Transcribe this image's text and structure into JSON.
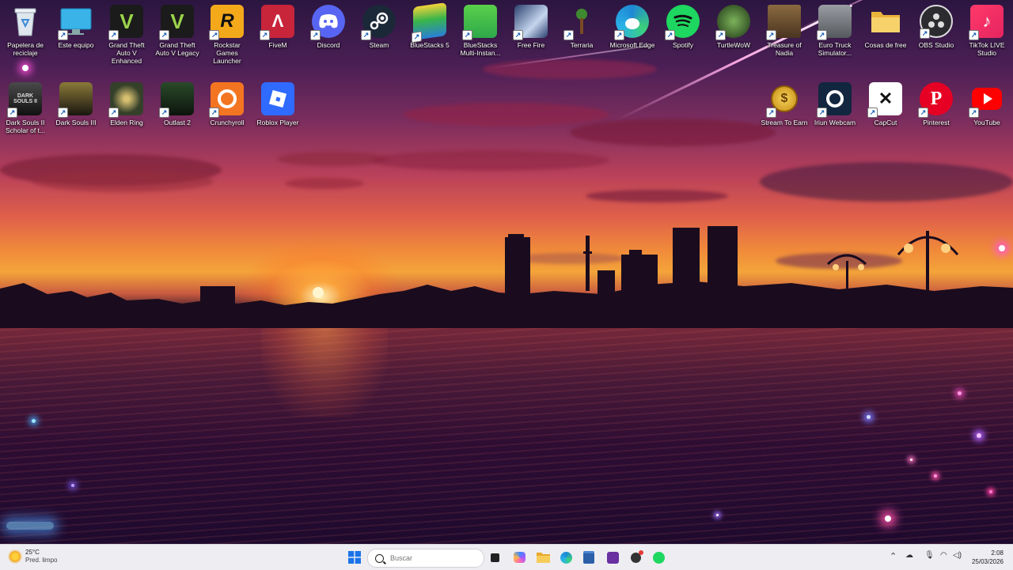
{
  "desktop": {
    "icons": [
      {
        "id": "papelera",
        "label": "Papelera de reciclaje",
        "icon": "recycle-bin-icon",
        "color": "#cfd6df"
      },
      {
        "id": "este-equipo",
        "label": "Este equipo",
        "icon": "computer-icon",
        "color": "#39b3e8"
      },
      {
        "id": "gta5-enhanced",
        "label": "Grand Theft Auto V Enhanced",
        "icon": "gta-v-icon",
        "color": "#1b1b1b"
      },
      {
        "id": "gta5-legacy",
        "label": "Grand Theft Auto V Legacy",
        "icon": "gta-v-icon",
        "color": "#1b1b1b"
      },
      {
        "id": "rockstar",
        "label": "Rockstar Games Launcher",
        "icon": "rockstar-icon",
        "color": "#f4a91b"
      },
      {
        "id": "fivem",
        "label": "FiveM",
        "icon": "fivem-icon",
        "color": "#c8243a"
      },
      {
        "id": "discord",
        "label": "Discord",
        "icon": "discord-icon",
        "color": "#5865f2"
      },
      {
        "id": "steam",
        "label": "Steam",
        "icon": "steam-icon",
        "color": "#1b2838"
      },
      {
        "id": "bluestacks5",
        "label": "BlueStacks 5",
        "icon": "bluestacks-icon",
        "color": "#2ea84a"
      },
      {
        "id": "bluestacks-multi",
        "label": "BlueStacks Multi-Instan...",
        "icon": "bluestacks-multi-icon",
        "color": "#3cc43a"
      },
      {
        "id": "freefire",
        "label": "Free Fire",
        "icon": "free-fire-icon",
        "color": "#2a3f6e"
      },
      {
        "id": "terraria",
        "label": "Terraria",
        "icon": "terraria-icon",
        "color": "#2f5e2a"
      },
      {
        "id": "edge",
        "label": "Microsoft Edge",
        "icon": "edge-icon",
        "color": "#1e88d4"
      },
      {
        "id": "spotify",
        "label": "Spotify",
        "icon": "spotify-icon",
        "color": "#1ed760"
      },
      {
        "id": "turtlewow",
        "label": "TurtleWoW",
        "icon": "turtlewow-icon",
        "color": "#4b6a3a"
      },
      {
        "id": "nadia",
        "label": "Treasure of Nadia",
        "icon": "nadia-icon",
        "color": "#6a5030"
      },
      {
        "id": "eurotruck",
        "label": "Euro Truck Simulator...",
        "icon": "euro-truck-icon",
        "color": "#6e6e70"
      },
      {
        "id": "cosas",
        "label": "Cosas de free",
        "icon": "folder-icon",
        "color": "#f2c94c"
      },
      {
        "id": "obs",
        "label": "OBS Studio",
        "icon": "obs-icon",
        "color": "#2c2c30"
      },
      {
        "id": "tiktok",
        "label": "TikTok LIVE Studio",
        "icon": "tiktok-icon",
        "color": "#e5245f"
      },
      {
        "id": "darksouls2",
        "label": "Dark Souls II Scholar of t...",
        "icon": "dark-souls-2-icon",
        "color": "#2a2a2a"
      },
      {
        "id": "darksouls3",
        "label": "Dark Souls III",
        "icon": "dark-souls-3-icon",
        "color": "#3a3320"
      },
      {
        "id": "eldenring",
        "label": "Elden Ring",
        "icon": "elden-ring-icon",
        "color": "#35402a"
      },
      {
        "id": "outlast2",
        "label": "Outlast 2",
        "icon": "outlast-icon",
        "color": "#1c2a1c"
      },
      {
        "id": "crunchyroll",
        "label": "Crunchyroll",
        "icon": "crunchyroll-icon",
        "color": "#f47521"
      },
      {
        "id": "roblox",
        "label": "Roblox Player",
        "icon": "roblox-icon",
        "color": "#2f6bff"
      },
      {
        "id": "streamtoearn",
        "label": "Stream To Earn",
        "icon": "coin-icon",
        "color": "#d9a521"
      },
      {
        "id": "iriun",
        "label": "Iriun Webcam",
        "icon": "webcam-icon",
        "color": "#12263f"
      },
      {
        "id": "capcut",
        "label": "CapCut",
        "icon": "capcut-icon",
        "color": "#ffffff"
      },
      {
        "id": "pinterest",
        "label": "Pinterest",
        "icon": "pinterest-icon",
        "color": "#e60023"
      },
      {
        "id": "youtube",
        "label": "YouTube",
        "icon": "youtube-icon",
        "color": "#ff0000"
      }
    ]
  },
  "taskbar": {
    "weather": {
      "temp": "25°C",
      "condition": "Pred. limpo",
      "icon": "sun-icon"
    },
    "search": {
      "placeholder": "Buscar"
    },
    "pinned": [
      {
        "id": "start",
        "icon": "windows-start-icon",
        "color": "#1a73e8"
      },
      {
        "id": "taskview",
        "icon": "task-view-icon",
        "color": "#222222"
      },
      {
        "id": "copilot",
        "icon": "copilot-icon",
        "color": "#7b5cff"
      },
      {
        "id": "explorer",
        "icon": "file-explorer-icon",
        "color": "#f2b83a"
      },
      {
        "id": "edge",
        "icon": "edge-icon",
        "color": "#1e88d4"
      },
      {
        "id": "store",
        "icon": "microsoft-store-icon",
        "color": "#2b5fa8"
      },
      {
        "id": "app-purple",
        "icon": "purple-app-icon",
        "color": "#6a2fa0"
      },
      {
        "id": "app-notify",
        "icon": "notify-app-icon",
        "color": "#333333"
      },
      {
        "id": "spotify",
        "icon": "spotify-icon",
        "color": "#1ed760"
      }
    ],
    "tray": {
      "icons": [
        "chevron-up-icon",
        "cloud-sync-icon",
        "microphone-icon",
        "wifi-icon",
        "volume-icon"
      ],
      "time": "2:08",
      "date": "25/03/2026"
    }
  }
}
